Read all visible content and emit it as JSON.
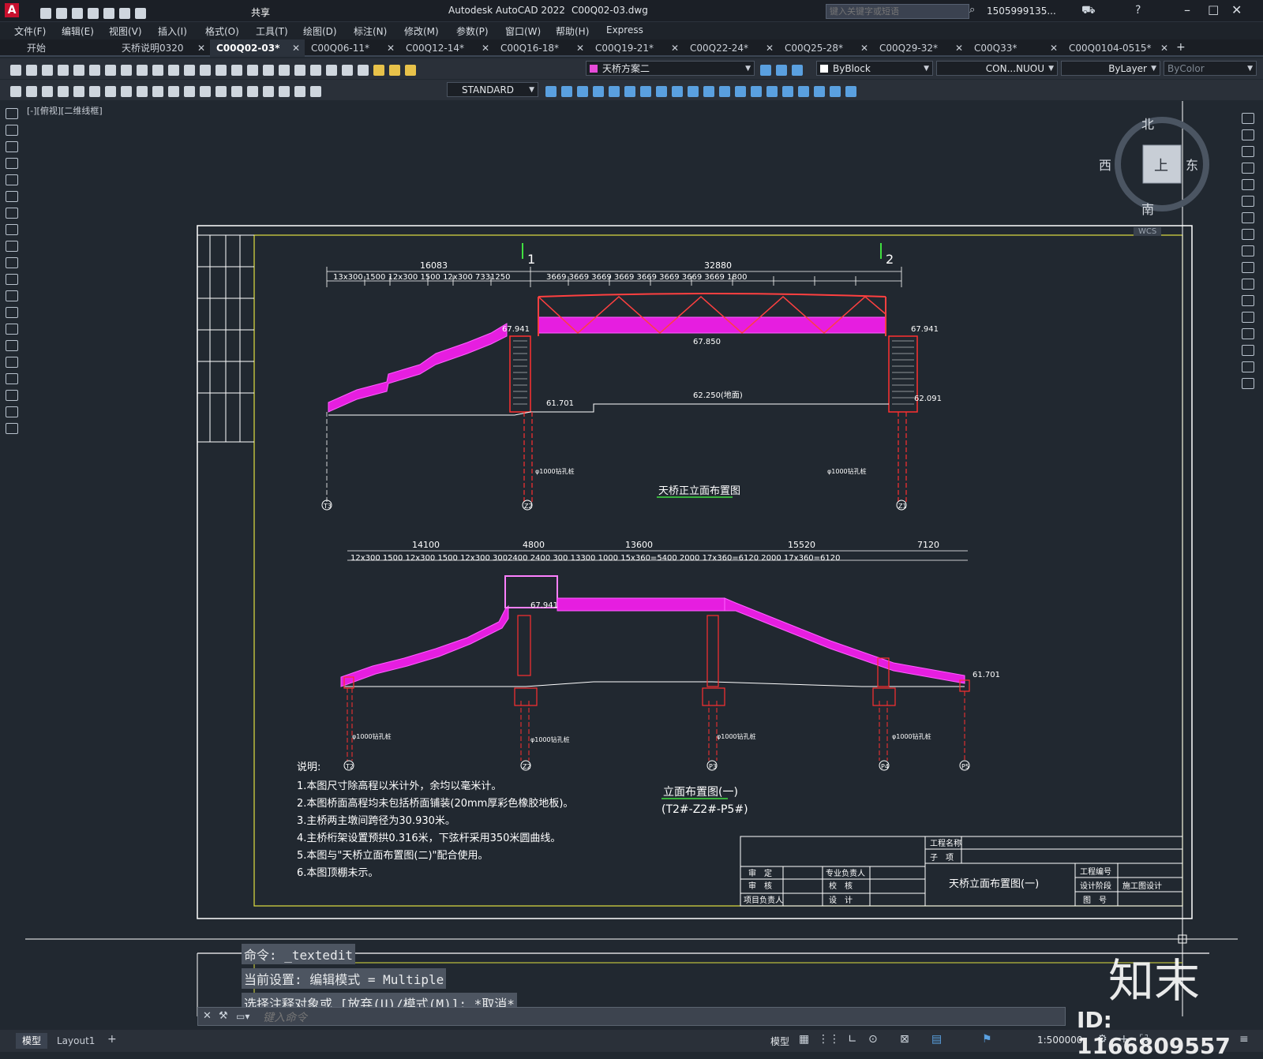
{
  "app": {
    "title": "Autodesk AutoCAD 2022",
    "file": "C00Q02-03.dwg",
    "share": "共享",
    "search_placeholder": "键入关键字或短语",
    "user": "1505999135..."
  },
  "menu": [
    "文件(F)",
    "编辑(E)",
    "视图(V)",
    "插入(I)",
    "格式(O)",
    "工具(T)",
    "绘图(D)",
    "标注(N)",
    "修改(M)",
    "参数(P)",
    "窗口(W)",
    "帮助(H)",
    "Express"
  ],
  "tabs": [
    {
      "label": "开始"
    },
    {
      "label": "天桥说明0320"
    },
    {
      "label": "C00Q02-03*",
      "active": true
    },
    {
      "label": "C00Q06-11*"
    },
    {
      "label": "C00Q12-14*"
    },
    {
      "label": "C00Q16-18*"
    },
    {
      "label": "C00Q19-21*"
    },
    {
      "label": "C00Q22-24*"
    },
    {
      "label": "C00Q25-28*"
    },
    {
      "label": "C00Q29-32*"
    },
    {
      "label": "C00Q33*"
    },
    {
      "label": "C00Q0104-0515*"
    }
  ],
  "toolbar": {
    "layer": "天桥方案二",
    "color": "ByBlock",
    "linetype": "CON...NUOU",
    "lineweight": "ByLayer",
    "plotstyle": "ByColor",
    "textstyle": "STANDARD"
  },
  "viewport_label": "[-][俯视][二维线框]",
  "viewcube": {
    "north": "北",
    "south": "南",
    "east": "东",
    "west": "西",
    "top": "上",
    "wcs": "WCS"
  },
  "drawing": {
    "title1": "天桥正立面布置图",
    "title2": "立面布置图(一)",
    "title2_sub": "(T2#-Z2#-P5#)",
    "elev1": "67.941",
    "elev2": "67.850",
    "elev3": "62.250(地面)",
    "elev4": "61.701",
    "elev5": "62.091",
    "top_dims": "16083  32880",
    "dims_row": "13x300 1500 12x300 1500 12x300 7331250 3669 3669 3669 3669 3669 3669 3669 3669 1800",
    "dims_row2": "14100 4800 13600 15520 7120",
    "pile": "φ1000钻孔桩",
    "axes": [
      "T3",
      "Z2",
      "Z1",
      "T2",
      "Z2",
      "P3",
      "P4",
      "P5"
    ],
    "notes_title": "说明:",
    "notes": [
      "1.本图尺寸除高程以米计外，余均以毫米计。",
      "2.本图桥面高程均未包括桥面铺装(20mm厚彩色橡胶地板)。",
      "3.主桥两主墩间跨径为30.930米。",
      "4.主桥桁架设置预拱0.316米，下弦杆采用350米圆曲线。",
      "5.本图与\"天桥立面布置图(二)\"配合使用。",
      "6.本图顶棚未示。"
    ],
    "titleblock": {
      "project": "工程名称",
      "sub": "子　项",
      "drawing_name": "天桥立面布置图(一)",
      "r1": [
        "审　定",
        "专业负责人",
        "工程编号"
      ],
      "r2": [
        "审　核",
        "校　核",
        "设计阶段",
        "施工图设计"
      ],
      "r3": [
        "项目负责人",
        "设　计",
        "图　号"
      ]
    }
  },
  "command": {
    "lines": [
      "命令: _textedit",
      "当前设置: 编辑模式 = Multiple",
      "选择注释对象或 [放弃(U)/模式(M)]: *取消*"
    ],
    "placeholder": "键入命令"
  },
  "status": {
    "tabs": [
      "模型",
      "Layout1"
    ],
    "model": "模型",
    "scale": "1:500000"
  },
  "watermark": {
    "brand": "知末",
    "id": "ID: 1166809557"
  }
}
